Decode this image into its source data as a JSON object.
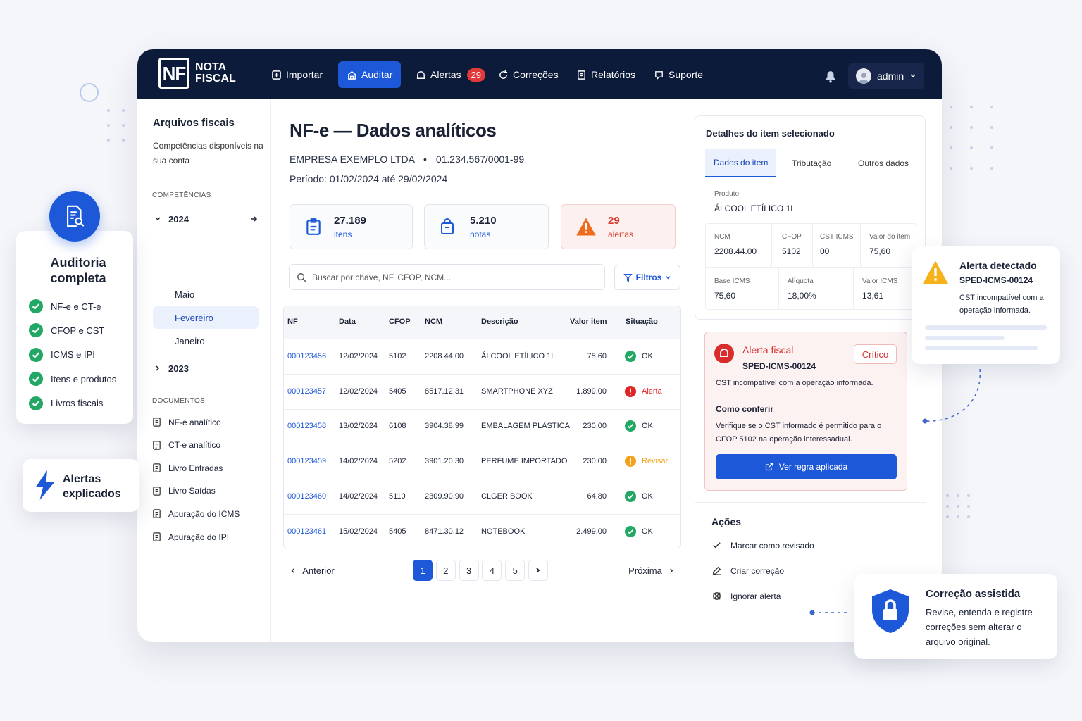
{
  "brand": {
    "logo_mark": "NF",
    "line1": "NOTA",
    "line2": "FISCAL"
  },
  "nav": {
    "importar": "Importar",
    "auditar": "Auditar",
    "alertas": "Alertas",
    "alertas_count": "29",
    "correcoes": "Correções",
    "relatorios": "Relatórios",
    "suporte": "Suporte",
    "user": "admin"
  },
  "sidebar": {
    "title": "Arquivos fiscais",
    "subtitle": "Competências disponíveis na sua conta",
    "competencias_label": "COMPETÊNCIAS",
    "year_2024": "2024",
    "months": [
      "Maio",
      "Fevereiro",
      "Janeiro"
    ],
    "selected_month": "Fevereiro",
    "year_2023": "2023",
    "documentos_label": "DOCUMENTOS",
    "docs": [
      "NF-e analítico",
      "CT-e analítico",
      "Livro Entradas",
      "Livro Saídas",
      "Apuração do ICMS",
      "Apuração do IPI"
    ]
  },
  "main": {
    "title": "NF-e — Dados analíticos",
    "company": "EMPRESA EXEMPLO LTDA",
    "cnpj": "01.234.567/0001-99",
    "period": "Período: 01/02/2024 até 29/02/2024",
    "stats": [
      {
        "value": "27.189",
        "label": "itens"
      },
      {
        "value": "5.210",
        "label": "notas"
      },
      {
        "value": "29",
        "label": "alertas"
      }
    ],
    "search_placeholder": "Buscar por chave, NF, CFOP, NCM...",
    "filters": "Filtros"
  },
  "table": {
    "headers": [
      "NF",
      "Data",
      "CFOP",
      "NCM",
      "Descrição",
      "Valor item",
      "Situação"
    ],
    "rows": [
      {
        "nf": "000123456",
        "data": "12/02/2024",
        "cfop": "5102",
        "ncm": "2208.44.00",
        "desc": "ÁLCOOL ETÍLICO 1L",
        "valor": "75,60",
        "status": "OK"
      },
      {
        "nf": "000123457",
        "data": "12/02/2024",
        "cfop": "5405",
        "ncm": "8517.12.31",
        "desc": "SMARTPHONE XYZ",
        "valor": "1.899,00",
        "status": "Alerta"
      },
      {
        "nf": "000123458",
        "data": "13/02/2024",
        "cfop": "6108",
        "ncm": "3904.38.99",
        "desc": "EMBALAGEM PLÁSTICA",
        "valor": "230,00",
        "status": "OK"
      },
      {
        "nf": "000123459",
        "data": "14/02/2024",
        "cfop": "5202",
        "ncm": "3901.20.30",
        "desc": "PERFUME IMPORTADO",
        "valor": "230,00",
        "status": "Revisar"
      },
      {
        "nf": "000123460",
        "data": "14/02/2024",
        "cfop": "5110",
        "ncm": "2309.90.90",
        "desc": "CLGER BOOK",
        "valor": "64,80",
        "status": "OK"
      },
      {
        "nf": "000123461",
        "data": "15/02/2024",
        "cfop": "5405",
        "ncm": "8471.30.12",
        "desc": "NOTEBOOK",
        "valor": "2.499,00",
        "status": "OK"
      }
    ]
  },
  "pagination": {
    "prev": "Anterior",
    "next": "Próxima",
    "pages": [
      "1",
      "2",
      "3",
      "4",
      "5"
    ],
    "current": "1"
  },
  "detail": {
    "title": "Detalhes do item selecionado",
    "tabs": [
      "Dados do item",
      "Tributação",
      "Outros dados"
    ],
    "produto_label": "Produto",
    "produto": "ÁLCOOL ETÍLICO 1L",
    "ncm_label": "NCM",
    "ncm": "2208.44.00",
    "cfop_label": "CFOP",
    "cfop": "5102",
    "cst_label": "CST ICMS",
    "cst": "00",
    "valor_label": "Valor do item",
    "valor": "75,60",
    "base_label": "Base ICMS",
    "base": "75,60",
    "aliquota_label": "Alíquota",
    "aliquota": "18,00%",
    "vicms_label": "Valor ICMS",
    "vicms": "13,61"
  },
  "alert": {
    "title": "Alerta fiscal",
    "badge": "Crítico",
    "code": "SPED-ICMS-00124",
    "message": "CST incompatível com a operação informada.",
    "how_title": "Como conferir",
    "how_text": "Verifique se o CST informado é permitido para o CFOP 5102 na operação interessadual.",
    "button": "Ver regra aplicada"
  },
  "acoes": {
    "title": "Ações",
    "items": [
      "Marcar como revisado",
      "Criar correção",
      "Ignorar alerta"
    ]
  },
  "float_audit": {
    "title": "Auditoria completa",
    "items": [
      "NF-e e CT-e",
      "CFOP e CST",
      "ICMS e IPI",
      "Itens e produtos",
      "Livros fiscais"
    ]
  },
  "float_alertas": {
    "title": "Alertas explicados"
  },
  "float_detected": {
    "title": "Alerta detectado",
    "code": "SPED-ICMS-00124",
    "message": "CST incompatível com a operação informada."
  },
  "float_correcao": {
    "title": "Correção assistida",
    "text": "Revise, entenda e registre correções sem alterar o arquivo original."
  },
  "colors": {
    "navy": "#0d1b3a",
    "accent": "#1d58d8",
    "danger": "#e13a3a",
    "ok": "#22a765",
    "warn": "#f4a21d"
  }
}
